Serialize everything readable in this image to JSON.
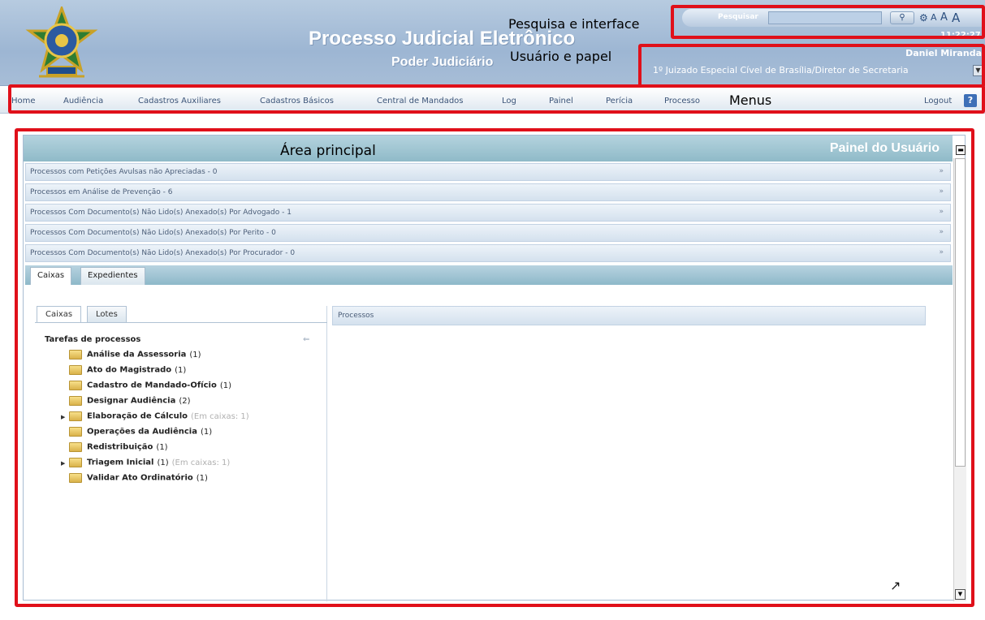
{
  "header": {
    "title": "Processo Judicial Eletrônico",
    "subtitle": "Poder Judiciário",
    "time": "11:22:27"
  },
  "search": {
    "label": "Pesquisar",
    "placeholder": "",
    "button_icon": "search-icon",
    "font_sizes": [
      "A",
      "A",
      "A"
    ]
  },
  "user": {
    "name": "Daniel Miranda",
    "role": "1º Juizado Especial Cível de Brasília/Diretor de Secretaria"
  },
  "annotations": {
    "search": "Pesquisa e interface",
    "user": "Usuário e papel",
    "menus": "Menus",
    "main": "Área principal"
  },
  "menu": {
    "items": [
      "Home",
      "Audiência",
      "Cadastros Auxiliares",
      "Cadastros Básicos",
      "Central de Mandados",
      "Log",
      "Painel",
      "Perícia",
      "Processo"
    ],
    "logout": "Logout",
    "help": "?"
  },
  "panel": {
    "title": "Painel do Usuário",
    "accordion": [
      "Processos com Petições Avulsas não Apreciadas - 0",
      "Processos em Análise de Prevenção - 6",
      "Processos Com Documento(s) Não Lido(s) Anexado(s) Por Advogado - 1",
      "Processos Com Documento(s) Não Lido(s) Anexado(s) Por Perito - 0",
      "Processos Com Documento(s) Não Lido(s) Anexado(s) Por Procurador - 0"
    ],
    "tabs": [
      "Caixas",
      "Expedientes"
    ],
    "subtabs": [
      "Caixas",
      "Lotes"
    ],
    "tree_title": "Tarefas de processos",
    "tree": [
      {
        "name": "Análise da Assessoria",
        "count": "(1)",
        "extra": ""
      },
      {
        "name": "Ato do Magistrado",
        "count": "(1)",
        "extra": ""
      },
      {
        "name": "Cadastro de Mandado-Ofício",
        "count": "(1)",
        "extra": ""
      },
      {
        "name": "Designar Audiência",
        "count": "(2)",
        "extra": ""
      },
      {
        "name": "Elaboração de Cálculo",
        "count": "",
        "extra": "(Em caixas: 1)"
      },
      {
        "name": "Operações da Audiência",
        "count": "(1)",
        "extra": ""
      },
      {
        "name": "Redistribuição",
        "count": "(1)",
        "extra": ""
      },
      {
        "name": "Triagem Inicial",
        "count": "(1)",
        "extra": "(Em caixas: 1)"
      },
      {
        "name": "Validar Ato Ordinatório",
        "count": "(1)",
        "extra": ""
      }
    ],
    "processes_title": "Processos"
  }
}
